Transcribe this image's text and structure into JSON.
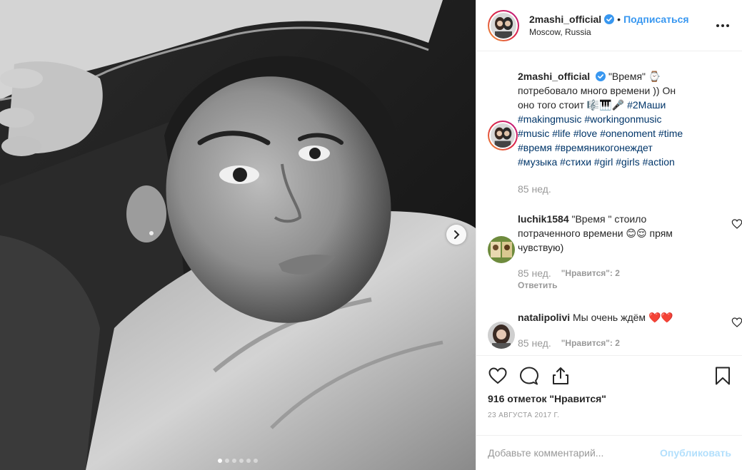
{
  "header": {
    "username": "2mashi_official",
    "separator": "•",
    "follow_label": "Подписаться",
    "location": "Moscow, Russia",
    "more_icon": "ellipsis-icon"
  },
  "caption": {
    "username": "2mashi_official",
    "text": "\"Время\" ⌚ потребовало много времени )) Он оно того стоит 🎼🎹🎤",
    "hashtags": [
      "#2Маши",
      "#makingmusic",
      "#workingonmusic",
      "#music",
      "#life",
      "#love",
      "#onenoment",
      "#time",
      "#время",
      "#времяникогонеждет",
      "#музыка",
      "#стихи",
      "#girl",
      "#girls",
      "#action"
    ],
    "time": "85 нед."
  },
  "comments": [
    {
      "username": "luchik1584",
      "text": "\"Время \" стоило потраченного времени 😊😌 прям чувствую)",
      "time": "85 нед.",
      "likes": "\"Нравится\": 2",
      "reply": "Ответить"
    },
    {
      "username": "natalipolivi",
      "text": "Мы очень ждём ❤️❤️",
      "time": "85 нед.",
      "likes": "\"Нравится\": 2"
    }
  ],
  "actions": {
    "likes_count": "916 отметок \"Нравится\"",
    "date": "23 АВГУСТА 2017 Г."
  },
  "composer": {
    "placeholder": "Добавьте комментарий...",
    "publish_label": "Опубликовать"
  },
  "carousel": {
    "total_slides": 6,
    "active_index": 0
  }
}
